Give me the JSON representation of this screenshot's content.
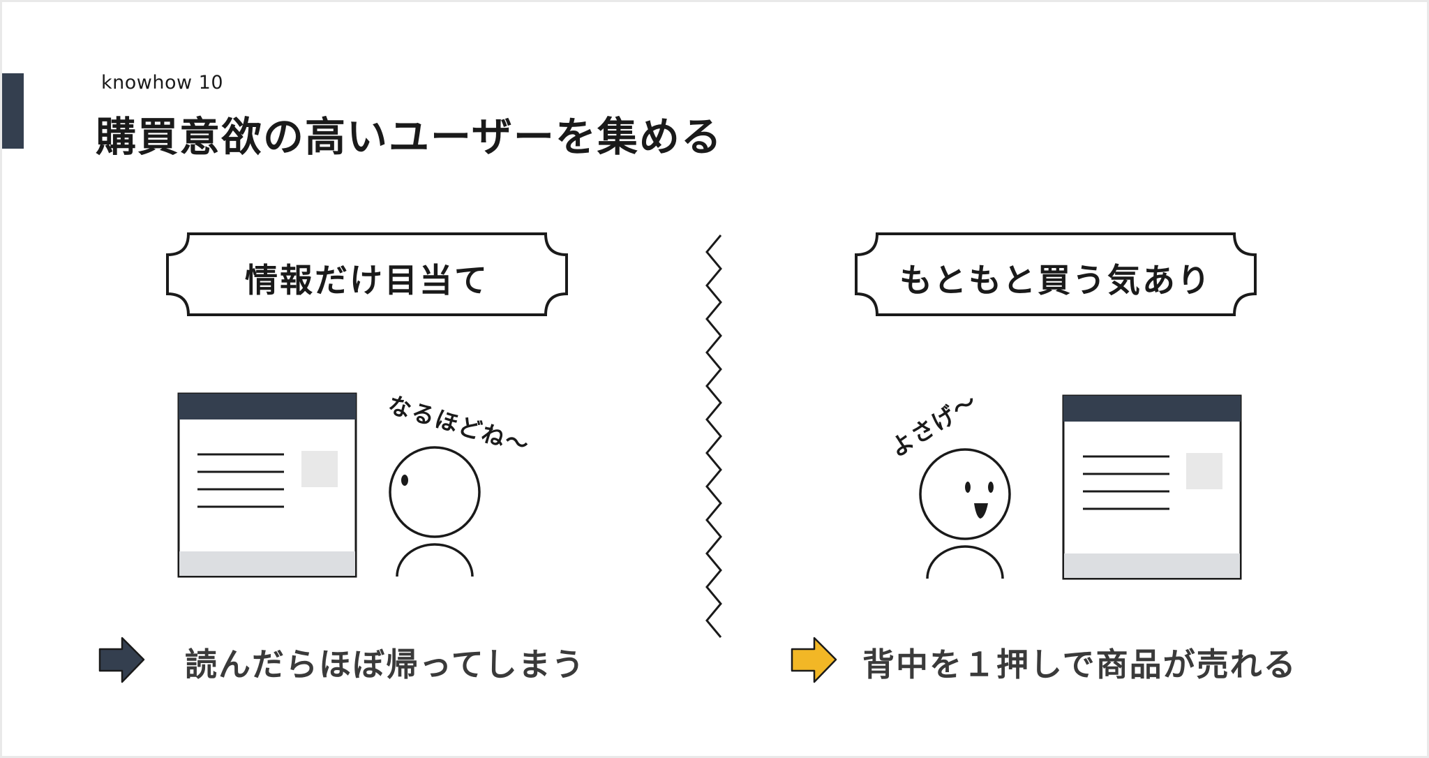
{
  "header": {
    "eyebrow": "knowhow 10",
    "title": "購買意欲の高いユーザーを集める"
  },
  "left": {
    "label": "情報だけ目当て",
    "speech": "なるほどね〜",
    "result": "読んだらほぼ帰ってしまう",
    "arrow_color": "#343f4f"
  },
  "right": {
    "label": "もともと買う気あり",
    "speech": "よさげ〜",
    "result": "背中を１押しで商品が売れる",
    "arrow_color": "#f2b726"
  },
  "colors": {
    "accent": "#343f4f",
    "browser_header": "#343f4f",
    "browser_footer": "#dcdee1",
    "thumbnail": "#e8e8e8",
    "arrow_dark": "#343f4f",
    "arrow_yellow": "#f2b726"
  }
}
